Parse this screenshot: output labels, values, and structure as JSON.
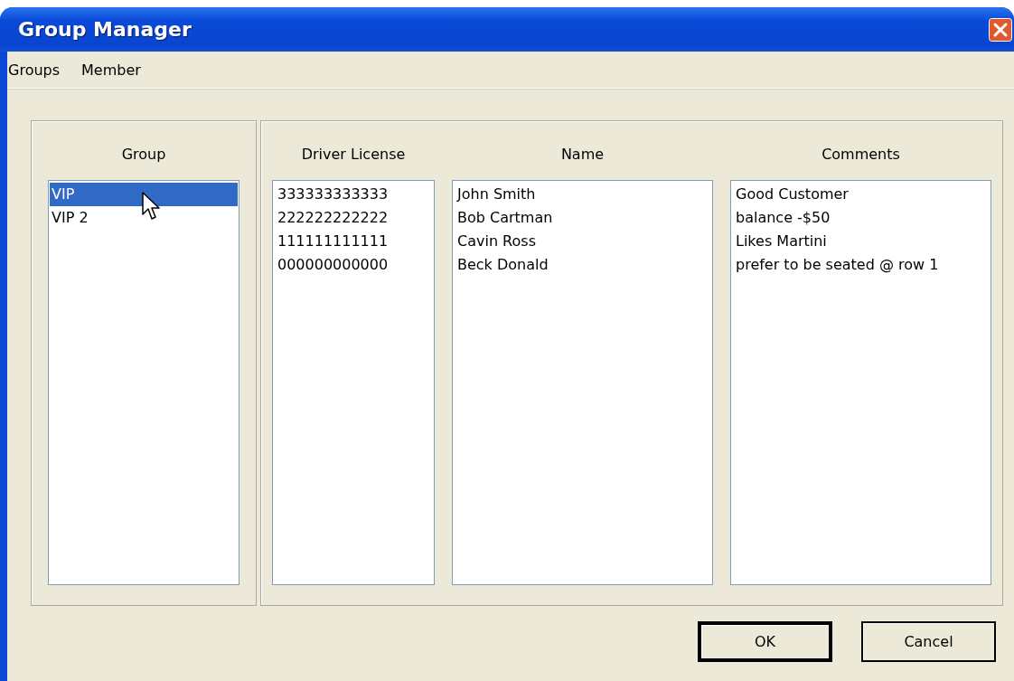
{
  "window": {
    "title": "Group Manager"
  },
  "menu": [
    {
      "label": "Groups"
    },
    {
      "label": "Member"
    }
  ],
  "groups": {
    "header": "Group",
    "items": [
      {
        "label": "VIP",
        "selected": true
      },
      {
        "label": "VIP 2",
        "selected": false
      }
    ]
  },
  "member_columns": [
    {
      "header": "Driver License",
      "items": [
        "333333333333",
        "222222222222",
        "111111111111",
        "000000000000"
      ]
    },
    {
      "header": "Name",
      "items": [
        "John Smith",
        "Bob Cartman",
        "Cavin Ross",
        "Beck Donald"
      ]
    },
    {
      "header": "Comments",
      "items": [
        "Good Customer",
        "balance -$50",
        "Likes Martini",
        "prefer to be seated @ row 1"
      ]
    }
  ],
  "buttons": [
    {
      "label": "OK",
      "default": true
    },
    {
      "label": "Cancel",
      "default": false
    }
  ]
}
